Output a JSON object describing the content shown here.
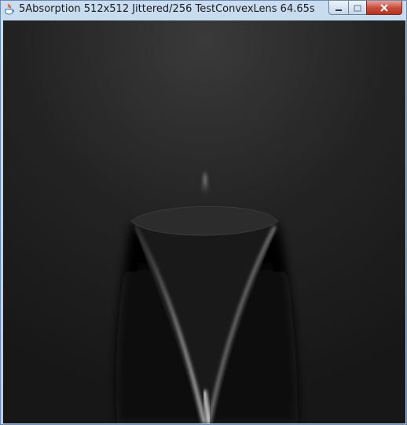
{
  "window": {
    "title": "5Absorption 512x512 Jittered/256  TestConvexLens 64.65s",
    "app_icon": "java-cup-icon",
    "buttons": {
      "minimize": "minimize-icon",
      "maximize": "maximize-icon",
      "close": "close-icon"
    }
  },
  "render": {
    "content": "rendered-image",
    "colors": {
      "background": "#1a1a1a",
      "highlight": "#e6e6e6"
    }
  }
}
